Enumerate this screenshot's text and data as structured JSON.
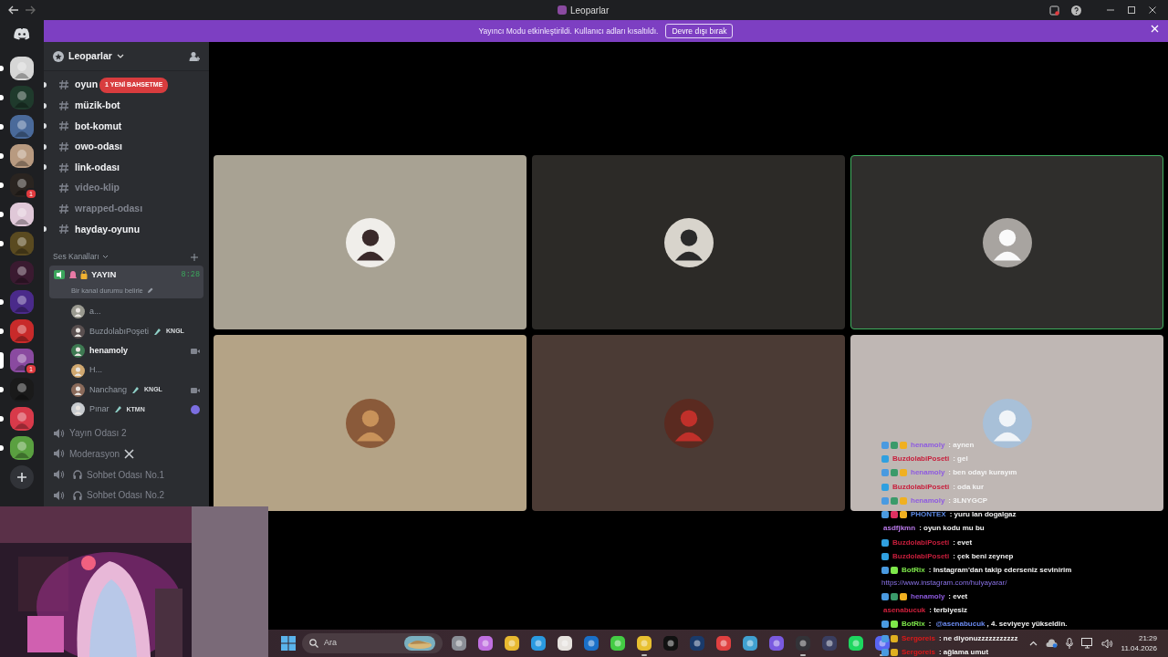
{
  "window": {
    "title": "Leoparlar"
  },
  "banner": {
    "text": "Yayıncı Modu etkinleştirildi. Kullanıcı adları kısaltıldı.",
    "button": "Devre dışı bırak"
  },
  "servers": [
    {
      "color": "#d6d6d6",
      "unread": true,
      "selected": false
    },
    {
      "color": "#1f3a2c",
      "unread": true,
      "selected": false
    },
    {
      "color": "#4a6a9a",
      "unread": true,
      "selected": false
    },
    {
      "color": "#b89a80",
      "unread": true,
      "selected": false
    },
    {
      "color": "#2a2420",
      "unread": true,
      "selected": false,
      "badge": "1"
    },
    {
      "color": "#e0c8d8",
      "unread": true,
      "selected": false
    },
    {
      "color": "#5a4a20",
      "unread": true,
      "selected": false
    },
    {
      "color": "#3a1a30",
      "unread": false,
      "selected": false
    },
    {
      "color": "#4a2a8a",
      "unread": true,
      "selected": false
    },
    {
      "color": "#c82a2a",
      "unread": true,
      "selected": false
    },
    {
      "color": "#8a4aa0",
      "unread": true,
      "selected": true,
      "badge": "1"
    },
    {
      "color": "#1a1a1a",
      "unread": true,
      "selected": false
    },
    {
      "color": "#d83a4a",
      "unread": true,
      "selected": false
    },
    {
      "color": "#5aa040",
      "unread": true,
      "selected": false
    }
  ],
  "guild": {
    "name": "Leoparlar"
  },
  "text_channels": [
    {
      "name": "oyun",
      "unread": true,
      "mention": "1 YENİ BAHSETME"
    },
    {
      "name": "müzik-bot",
      "unread": true
    },
    {
      "name": "bot-komut",
      "unread": true
    },
    {
      "name": "owo-odası",
      "unread": true
    },
    {
      "name": "link-odası",
      "unread": true
    },
    {
      "name": "video-klip",
      "unread": false
    },
    {
      "name": "wrapped-odası",
      "unread": false
    },
    {
      "name": "hayday-oyunu",
      "unread": true
    }
  ],
  "voice_category": "Ses Kanalları",
  "voice_channels": [
    {
      "name": "YAYIN",
      "kind": "stream",
      "selected": true,
      "time": "8:28",
      "status": "Bir kanal durumu belirle",
      "members": [
        {
          "name": "a...",
          "highlighted": false,
          "live": false,
          "activity": false
        },
        {
          "name": "BuzdolabıPoşeti",
          "tag": "KNGL",
          "highlighted": false,
          "live": false,
          "activity": false
        },
        {
          "name": "henamoly",
          "highlighted": true,
          "live": true,
          "activity": false
        },
        {
          "name": "H...",
          "highlighted": false,
          "live": false,
          "activity": false
        },
        {
          "name": "Nanchang",
          "tag": "KNGL",
          "highlighted": false,
          "live": true,
          "activity": false
        },
        {
          "name": "Pınar",
          "tag": "KTMN",
          "highlighted": false,
          "live": false,
          "activity": true
        }
      ]
    },
    {
      "name": "Yayın Odası 2",
      "kind": "plain",
      "selected": false
    },
    {
      "name": "Moderasyon",
      "kind": "mod",
      "selected": false
    },
    {
      "name": "Sohbet Odası No.1",
      "kind": "lounge",
      "selected": false
    },
    {
      "name": "Sohbet Odası No.2",
      "kind": "lounge",
      "selected": false
    }
  ],
  "tiles": [
    {
      "color": "#a8a293",
      "speaking": false
    },
    {
      "color": "#2c2a27",
      "speaking": false
    },
    {
      "color": "#2f2e2c",
      "speaking": true
    },
    {
      "color": "#b4a386",
      "speaking": false
    },
    {
      "color": "#4b3b35",
      "speaking": false
    },
    {
      "color": "#bfb7b4",
      "speaking": false
    }
  ],
  "chat": [
    {
      "user": "henamoly",
      "color": "#8e5ae0",
      "badges": [
        {
          "color": "#4a9ae0"
        },
        {
          "color": "#3a9a6a"
        },
        {
          "color": "#f0b020"
        }
      ],
      "text": ": aynen"
    },
    {
      "user": "BuzdolabiPoseti",
      "color": "#c81e3c",
      "badges": [
        {
          "color": "#30a0e0"
        }
      ],
      "text": ": gel"
    },
    {
      "user": "henamoly",
      "color": "#8e5ae0",
      "badges": [
        {
          "color": "#4a9ae0"
        },
        {
          "color": "#3a9a6a"
        },
        {
          "color": "#f0b020"
        }
      ],
      "text": ": ben odayı kurayım"
    },
    {
      "user": "BuzdolabiPoseti",
      "color": "#c81e3c",
      "badges": [
        {
          "color": "#30a0e0"
        }
      ],
      "text": ": oda kur"
    },
    {
      "user": "henamoly",
      "color": "#8e5ae0",
      "badges": [
        {
          "color": "#4a9ae0"
        },
        {
          "color": "#3a9a6a"
        },
        {
          "color": "#f0b020"
        }
      ],
      "text": ": 3LNYGCP"
    },
    {
      "user": "PHONTEX",
      "color": "#5a86e0",
      "badges": [
        {
          "color": "#4a9ae0"
        },
        {
          "color": "#e03060"
        },
        {
          "color": "#f0b020"
        }
      ],
      "text": ": yuru lan dogalgaz"
    },
    {
      "user": "asdfjkmn",
      "color": "#b878e8",
      "text": ": oyun kodu mu bu"
    },
    {
      "user": "BuzdolabiPoseti",
      "color": "#c81e3c",
      "badges": [
        {
          "color": "#30a0e0"
        }
      ],
      "text": ": evet"
    },
    {
      "user": "BuzdolabiPoseti",
      "color": "#c81e3c",
      "badges": [
        {
          "color": "#30a0e0"
        }
      ],
      "text": ": çek beni zeynep"
    },
    {
      "user": "BotRix",
      "color": "#7ee84a",
      "badges": [
        {
          "color": "#4a9ae0"
        },
        {
          "color": "#7ee84a"
        }
      ],
      "text": ": Instagram'dan takip ederseniz sevinirim",
      "link": "https://www.instagram.com/hulyayarar/"
    },
    {
      "user": "henamoly",
      "color": "#8e5ae0",
      "badges": [
        {
          "color": "#4a9ae0"
        },
        {
          "color": "#3a9a6a"
        },
        {
          "color": "#f0b020"
        }
      ],
      "text": ": evet"
    },
    {
      "user": "asenabucuk",
      "color": "#d0203c",
      "text": ": terbiyesiz"
    },
    {
      "user": "BotRix",
      "color": "#7ee84a",
      "badges": [
        {
          "color": "#4a9ae0"
        },
        {
          "color": "#7ee84a"
        }
      ],
      "text": ":",
      "mention": "@asenabucuk",
      "after": ", 4. seviyeye yükseldin."
    },
    {
      "user": "Sergoreis",
      "color": "#e01818",
      "badges": [
        {
          "color": "#4a9ae0"
        },
        {
          "color": "#e0b020"
        }
      ],
      "text": ": ne diyonuzzzzzzzzzzz"
    },
    {
      "user": "Sergoreis",
      "color": "#e01818",
      "badges": [
        {
          "color": "#4a9ae0"
        },
        {
          "color": "#e0b020"
        }
      ],
      "text": ": ağlama umut"
    }
  ],
  "taskbar": {
    "search": {
      "placeholder": "Ara"
    },
    "apps": [
      {
        "color": "#8a8e96",
        "running": false
      },
      {
        "color": "#c070e0",
        "running": false
      },
      {
        "color": "#e8b830",
        "running": false
      },
      {
        "color": "#2a9ae0",
        "running": false
      },
      {
        "color": "#e6e2de",
        "running": false
      },
      {
        "color": "#1a70c8",
        "running": false
      },
      {
        "color": "#44cc44",
        "running": false
      },
      {
        "color": "#e8c030",
        "running": true
      },
      {
        "color": "#111111",
        "running": false
      },
      {
        "color": "#1a3a6a",
        "running": false
      },
      {
        "color": "#e04040",
        "running": false
      },
      {
        "color": "#40a0d0",
        "running": false
      },
      {
        "color": "#7a5ae0",
        "running": false
      },
      {
        "color": "#333338",
        "running": true
      },
      {
        "color": "#3a3e60",
        "running": false
      },
      {
        "color": "#1ed760",
        "running": false
      },
      {
        "color": "#5865f2",
        "running": true
      }
    ],
    "time": "21:29",
    "date": "11.04.2026"
  }
}
